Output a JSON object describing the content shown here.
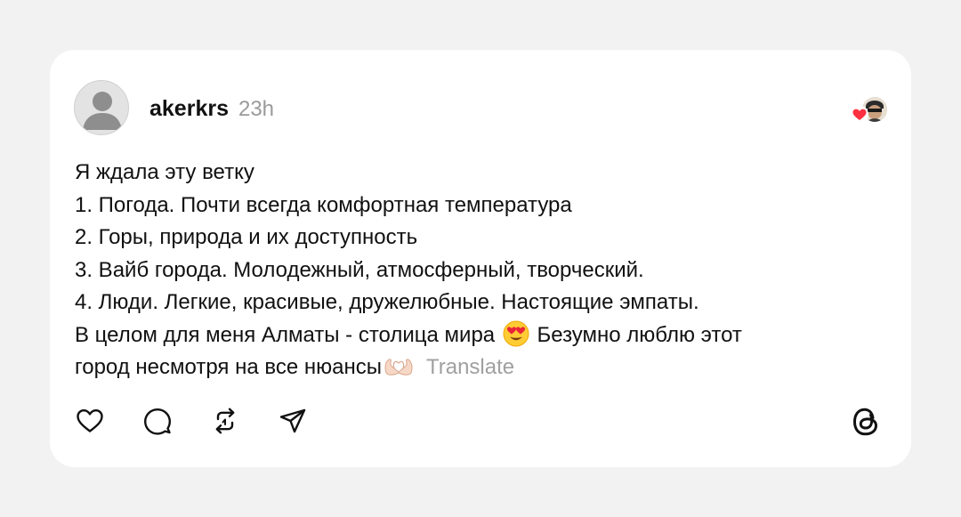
{
  "post": {
    "username": "akerkrs",
    "time": "23h",
    "lines": [
      "Я ждала эту ветку",
      "1. Погода. Почти всегда комфортная температура",
      "2. Горы, природа и их доступность",
      "3. Вайб города. Молодежный, атмосферный, творческий.",
      "4. Люди. Легкие, красивые, дружелюбные. Настоящие эмпаты."
    ],
    "line6_before_emoji": "В целом для меня Алматы - столица мира",
    "line6_after_emoji": "Безумно люблю этот",
    "line7_text": "город несмотря на все нюансы",
    "translate_label": "Translate"
  },
  "icons": {
    "avatar": "default-user-avatar",
    "reaction": "heart-icon",
    "emoji_1": "smiling-face-with-heart-eyes",
    "emoji_2": "heart-hands",
    "like": "heart-outline-icon",
    "comment": "comment-bubble-icon",
    "repost": "repost-icon",
    "share": "send-icon",
    "brand": "threads-logo"
  },
  "colors": {
    "background": "#f2f2f2",
    "card": "#ffffff",
    "text": "#111111",
    "muted": "#9a9a9a",
    "heart": "#ff3040"
  }
}
